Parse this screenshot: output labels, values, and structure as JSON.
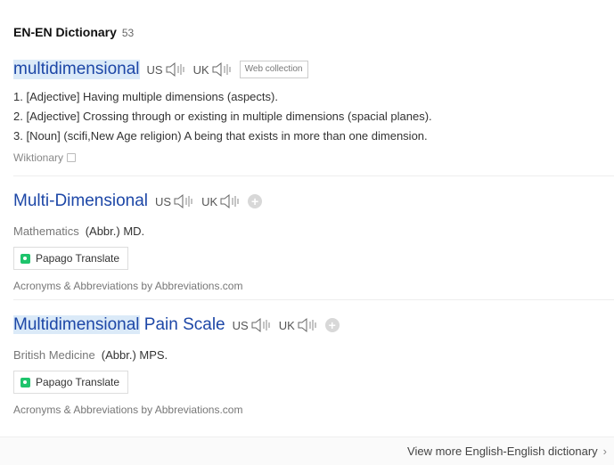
{
  "header": {
    "title": "EN-EN Dictionary",
    "count": "53"
  },
  "entries": [
    {
      "word": "multidimensional",
      "us_label": "US",
      "uk_label": "UK",
      "tag": "Web collection",
      "definitions": [
        "1. [Adjective] Having multiple dimensions (aspects).",
        "2. [Adjective] Crossing through or existing in multiple dimensions (spacial planes).",
        "3. [Noun] (scifi,New Age religion) A being that exists in more than one dimension."
      ],
      "source": "Wiktionary"
    },
    {
      "word": "Multi-Dimensional",
      "us_label": "US",
      "uk_label": "UK",
      "field": "Mathematics",
      "abbr": "(Abbr.) MD.",
      "papago": "Papago Translate",
      "credit": "Acronyms & Abbreviations by Abbreviations.com"
    },
    {
      "word_hl": "Multidimensional",
      "word_rest": " Pain Scale",
      "us_label": "US",
      "uk_label": "UK",
      "field": "British Medicine",
      "abbr": "(Abbr.) MPS.",
      "papago": "Papago Translate",
      "credit": "Acronyms & Abbreviations by Abbreviations.com"
    }
  ],
  "footer": {
    "more": "View more English-English dictionary"
  }
}
